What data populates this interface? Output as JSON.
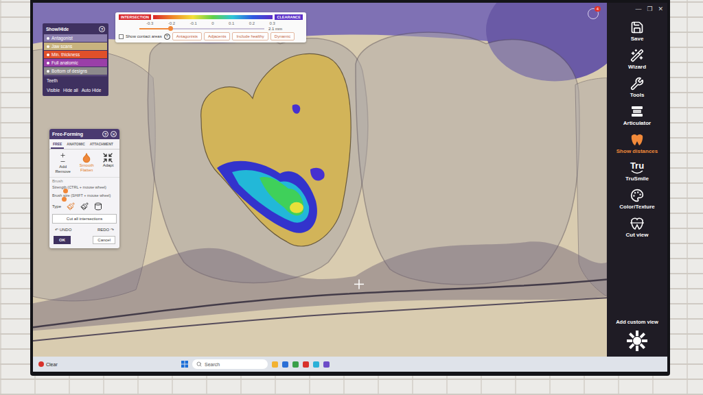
{
  "notification_badge": "4",
  "window_controls": [
    "—",
    "❐",
    "✕"
  ],
  "show_hide": {
    "title": "Show/Hide",
    "help": "?",
    "items": [
      {
        "label": "Antagonist",
        "color": "#8c7fae"
      },
      {
        "label": "Jaw scans",
        "color": "#c8b37e"
      },
      {
        "label": "Min. thickness",
        "color": "#e0502a"
      },
      {
        "label": "Full anatomic",
        "color": "#9a3fa8"
      },
      {
        "label": "Bottom of designs",
        "color": "#8d8a8c"
      }
    ],
    "group": "Teeth",
    "visible": "Visible",
    "hide_all": "Hide all",
    "auto_hide": "Auto Hide"
  },
  "distance_bar": {
    "left_label": "INTERSECTION",
    "right_label": "CLEARANCE",
    "ticks": [
      "-0.3",
      "-0.2",
      "-0.1",
      "0",
      "0.1",
      "0.2",
      "0.3"
    ],
    "level": 0.25,
    "value": "2.1 mm",
    "contact": {
      "label": "Show contact areas",
      "checked": false
    },
    "help": "?",
    "toggles": [
      {
        "label": "Antagonists",
        "selected": false
      },
      {
        "label": "Adjacents",
        "selected": false
      },
      {
        "label": "Include healthy",
        "selected": false
      },
      {
        "label": "Dynamic",
        "selected": false
      }
    ]
  },
  "free_forming": {
    "title": "Free-Forming",
    "help": "?",
    "close": "✕",
    "tabs": [
      {
        "label": "FREE",
        "selected": true
      },
      {
        "label": "ANATOMIC",
        "selected": false
      },
      {
        "label": "ATTACHMENT",
        "selected": false
      }
    ],
    "tools": [
      {
        "lines": [
          "Add",
          "Remove"
        ],
        "selected": false
      },
      {
        "lines": [
          "Smooth",
          "Flatten"
        ],
        "selected": true
      },
      {
        "lines": [
          "Adapt"
        ],
        "selected": false
      }
    ],
    "brush_label": "Brush",
    "sliders": [
      {
        "label": "Strength (CTRL + mouse wheel)",
        "level": 0.2
      },
      {
        "label": "Brush size (SHIFT + mouse wheel)",
        "level": 0.18
      }
    ],
    "type_label": "Type",
    "cut_button": "Cut all intersections",
    "undo": {
      "glyph": "↶",
      "label": "UNDO"
    },
    "redo": {
      "label": "REDO",
      "glyph": "↷"
    },
    "ok": "OK",
    "cancel": "Cancel"
  },
  "toolbar": {
    "items": [
      {
        "label": "Save",
        "selected": false
      },
      {
        "label": "Wizard",
        "selected": false
      },
      {
        "label": "Tools",
        "selected": false
      },
      {
        "label": "Articulator",
        "selected": false
      },
      {
        "label": "Show distances",
        "selected": true
      },
      {
        "label": "TruSmile",
        "selected": false,
        "icon_text": "Tru"
      },
      {
        "label": "Color/Texture",
        "selected": false
      },
      {
        "label": "Cut view",
        "selected": false
      }
    ],
    "add_custom_view": "Add custom view"
  },
  "taskbar": {
    "weather": "Clear",
    "search": "Search"
  }
}
